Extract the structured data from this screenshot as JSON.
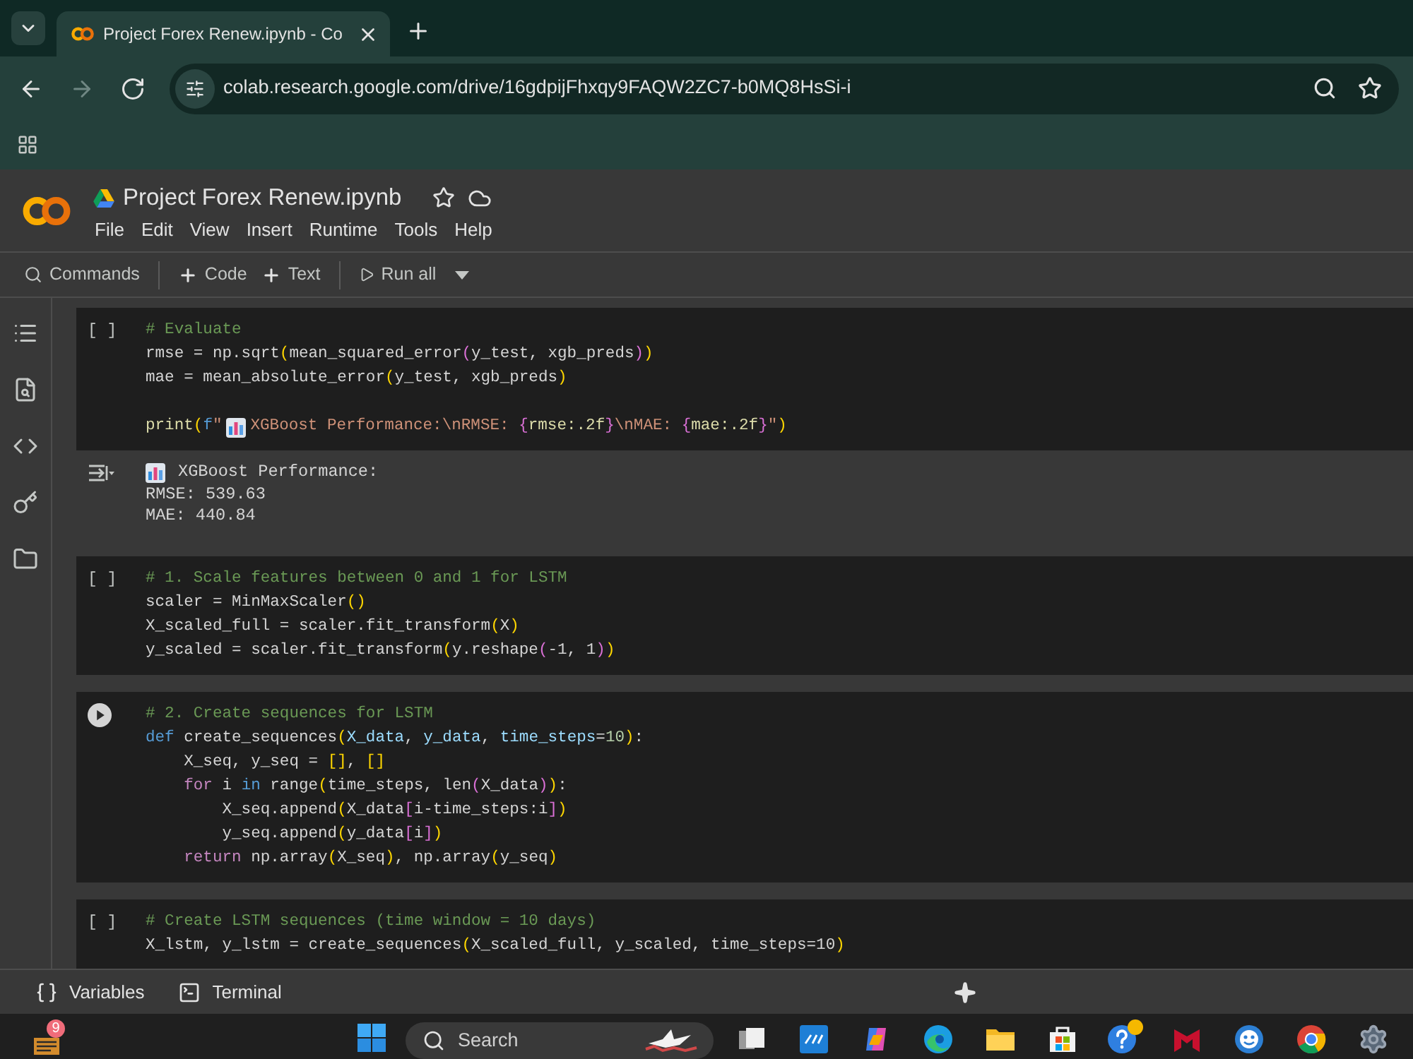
{
  "browser": {
    "tab": {
      "title": "Project Forex Renew.ipynb - Co"
    },
    "nav": [
      {
        "kind": "back",
        "disabled": false
      },
      {
        "kind": "forward",
        "disabled": true
      },
      {
        "kind": "reload",
        "disabled": false
      }
    ],
    "url": "colab.research.google.com/drive/16gdpijFhxqy9FAQW2ZC7-b0MQ8HsSi-i"
  },
  "notebook": {
    "title": "Project Forex Renew.ipynb",
    "menu": [
      "File",
      "Edit",
      "View",
      "Insert",
      "Runtime",
      "Tools",
      "Help"
    ],
    "toolbar": [
      {
        "kind": "search",
        "label": "Commands"
      },
      {
        "kind": "add",
        "label": "Code"
      },
      {
        "kind": "add",
        "label": "Text"
      },
      {
        "kind": "run",
        "label": "Run all"
      }
    ]
  },
  "cells": [
    {
      "gutter": {
        "kind": "bracket",
        "text": "[ ]"
      },
      "lines": [
        [
          {
            "kind": "comment",
            "text": "# Evaluate"
          }
        ],
        [
          {
            "kind": "plain",
            "text": "rmse = np.sqrt"
          },
          {
            "kind": "bracket1",
            "text": "("
          },
          {
            "kind": "plain",
            "text": "mean_squared_error"
          },
          {
            "kind": "bracket2",
            "text": "("
          },
          {
            "kind": "plain",
            "text": "y_test, xgb_preds"
          },
          {
            "kind": "bracket2",
            "text": ")"
          },
          {
            "kind": "bracket1",
            "text": ")"
          }
        ],
        [
          {
            "kind": "plain",
            "text": "mae = mean_absolute_error"
          },
          {
            "kind": "bracket1",
            "text": "("
          },
          {
            "kind": "plain",
            "text": "y_test, xgb_preds"
          },
          {
            "kind": "bracket1",
            "text": ")"
          }
        ],
        [
          {
            "kind": "blank"
          }
        ],
        [
          {
            "kind": "function",
            "text": "print"
          },
          {
            "kind": "bracket1",
            "text": "("
          },
          {
            "kind": "keyword",
            "text": "f"
          },
          {
            "kind": "string",
            "text": "\""
          },
          {
            "kind": "chart_emoji"
          },
          {
            "kind": "string",
            "text": "XGBoost Performance:\\nRMSE: "
          },
          {
            "kind": "bracket2",
            "text": "{"
          },
          {
            "kind": "function",
            "text": "rmse:.2f"
          },
          {
            "kind": "bracket2",
            "text": "}"
          },
          {
            "kind": "string",
            "text": "\\nMAE: "
          },
          {
            "kind": "bracket2",
            "text": "{"
          },
          {
            "kind": "function",
            "text": "mae:.2f"
          },
          {
            "kind": "bracket2",
            "text": "}"
          },
          {
            "kind": "string",
            "text": "\""
          },
          {
            "kind": "bracket1",
            "text": ")"
          }
        ]
      ],
      "output": {
        "lines": [
          [
            {
              "kind": "chart_emoji"
            },
            {
              "kind": "plain",
              "text": "XGBoost Performance:"
            }
          ],
          [
            {
              "kind": "plain",
              "text": "RMSE: 539.63"
            }
          ],
          [
            {
              "kind": "plain",
              "text": "MAE: 440.84"
            }
          ]
        ]
      }
    },
    {
      "gutter": {
        "kind": "bracket",
        "text": "[ ]"
      },
      "lines": [
        [
          {
            "kind": "comment",
            "text": "# 1. Scale features between 0 and 1 for LSTM"
          }
        ],
        [
          {
            "kind": "plain",
            "text": "scaler = MinMaxScaler"
          },
          {
            "kind": "bracket1",
            "text": "()"
          }
        ],
        [
          {
            "kind": "plain",
            "text": "X_scaled_full = scaler.fit_transform"
          },
          {
            "kind": "bracket1",
            "text": "("
          },
          {
            "kind": "plain",
            "text": "X"
          },
          {
            "kind": "bracket1",
            "text": ")"
          }
        ],
        [
          {
            "kind": "plain",
            "text": "y_scaled = scaler.fit_transform"
          },
          {
            "kind": "bracket1",
            "text": "("
          },
          {
            "kind": "plain",
            "text": "y.reshape"
          },
          {
            "kind": "bracket2",
            "text": "("
          },
          {
            "kind": "plain",
            "text": "-1, 1"
          },
          {
            "kind": "bracket2",
            "text": ")"
          },
          {
            "kind": "bracket1",
            "text": ")"
          }
        ]
      ]
    },
    {
      "gutter": {
        "kind": "run_button"
      },
      "lines": [
        [
          {
            "kind": "comment",
            "text": "# 2. Create sequences for LSTM"
          }
        ],
        [
          {
            "kind": "keyword",
            "text": "def"
          },
          {
            "kind": "plain",
            "text": " create_sequences"
          },
          {
            "kind": "bracket1",
            "text": "("
          },
          {
            "kind": "param",
            "text": "X_data"
          },
          {
            "kind": "plain",
            "text": ", "
          },
          {
            "kind": "param",
            "text": "y_data"
          },
          {
            "kind": "plain",
            "text": ", "
          },
          {
            "kind": "param",
            "text": "time_steps"
          },
          {
            "kind": "plain",
            "text": "="
          },
          {
            "kind": "number",
            "text": "10"
          },
          {
            "kind": "bracket1",
            "text": ")"
          },
          {
            "kind": "plain",
            "text": ":"
          }
        ],
        [
          {
            "kind": "plain",
            "text": "    X_seq, y_seq = "
          },
          {
            "kind": "bracket1",
            "text": "[]"
          },
          {
            "kind": "plain",
            "text": ", "
          },
          {
            "kind": "bracket1",
            "text": "[]"
          }
        ],
        [
          {
            "kind": "control",
            "text": "    for"
          },
          {
            "kind": "plain",
            "text": " i "
          },
          {
            "kind": "keyword",
            "text": "in"
          },
          {
            "kind": "plain",
            "text": " range"
          },
          {
            "kind": "bracket1",
            "text": "("
          },
          {
            "kind": "plain",
            "text": "time_steps, len"
          },
          {
            "kind": "bracket2",
            "text": "("
          },
          {
            "kind": "plain",
            "text": "X_data"
          },
          {
            "kind": "bracket2",
            "text": ")"
          },
          {
            "kind": "bracket1",
            "text": ")"
          },
          {
            "kind": "plain",
            "text": ":"
          }
        ],
        [
          {
            "kind": "plain",
            "text": "        X_seq.append"
          },
          {
            "kind": "bracket1",
            "text": "("
          },
          {
            "kind": "plain",
            "text": "X_data"
          },
          {
            "kind": "bracket2",
            "text": "["
          },
          {
            "kind": "plain",
            "text": "i-time_steps:i"
          },
          {
            "kind": "bracket2",
            "text": "]"
          },
          {
            "kind": "bracket1",
            "text": ")"
          }
        ],
        [
          {
            "kind": "plain",
            "text": "        y_seq.append"
          },
          {
            "kind": "bracket1",
            "text": "("
          },
          {
            "kind": "plain",
            "text": "y_data"
          },
          {
            "kind": "bracket2",
            "text": "["
          },
          {
            "kind": "plain",
            "text": "i"
          },
          {
            "kind": "bracket2",
            "text": "]"
          },
          {
            "kind": "bracket1",
            "text": ")"
          }
        ],
        [
          {
            "kind": "control",
            "text": "    return"
          },
          {
            "kind": "plain",
            "text": " np.array"
          },
          {
            "kind": "bracket1",
            "text": "("
          },
          {
            "kind": "plain",
            "text": "X_seq"
          },
          {
            "kind": "bracket1",
            "text": ")"
          },
          {
            "kind": "plain",
            "text": ", np.array"
          },
          {
            "kind": "bracket1",
            "text": "("
          },
          {
            "kind": "plain",
            "text": "y_seq"
          },
          {
            "kind": "bracket1",
            "text": ")"
          }
        ]
      ]
    },
    {
      "gutter": {
        "kind": "bracket",
        "text": "[ ]"
      },
      "lines": [
        [
          {
            "kind": "comment",
            "text": "# Create LSTM sequences (time window = 10 days)"
          }
        ],
        [
          {
            "kind": "plain",
            "text": "X_lstm, y_lstm = create_sequences"
          },
          {
            "kind": "bracket1",
            "text": "("
          },
          {
            "kind": "plain",
            "text": "X_scaled_full, y_scaled, time_steps=10"
          },
          {
            "kind": "bracket1",
            "text": ")"
          }
        ]
      ]
    }
  ],
  "bottom_bar": [
    {
      "kind": "variables",
      "label": "Variables"
    },
    {
      "kind": "terminal",
      "label": "Terminal"
    }
  ],
  "taskbar": {
    "widget_badge": "9",
    "search": {
      "placeholder": "Search"
    }
  }
}
